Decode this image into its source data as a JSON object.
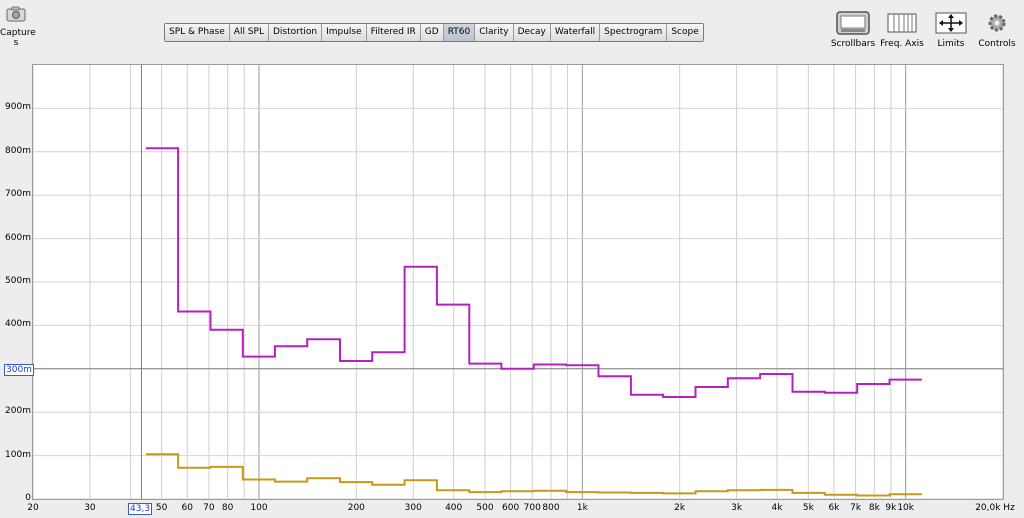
{
  "capture": {
    "label": "Capture",
    "label2": "s"
  },
  "tabs": [
    {
      "label": "SPL & Phase",
      "active": false
    },
    {
      "label": "All SPL",
      "active": false
    },
    {
      "label": "Distortion",
      "active": false
    },
    {
      "label": "Impulse",
      "active": false
    },
    {
      "label": "Filtered IR",
      "active": false
    },
    {
      "label": "GD",
      "active": false
    },
    {
      "label": "RT60",
      "active": true
    },
    {
      "label": "Clarity",
      "active": false
    },
    {
      "label": "Decay",
      "active": false
    },
    {
      "label": "Waterfall",
      "active": false
    },
    {
      "label": "Spectrogram",
      "active": false
    },
    {
      "label": "Scope",
      "active": false
    }
  ],
  "tools": {
    "scrollbars": "Scrollbars",
    "freq_axis": "Freq. Axis",
    "limits": "Limits",
    "controls": "Controls"
  },
  "markers": {
    "x_cursor": "43,3",
    "y_cursor": "300m"
  },
  "colors": {
    "series_1": "#b520c0",
    "series_2": "#c49a18",
    "cursor": "#808080"
  },
  "chart_data": {
    "type": "line",
    "x_scale": "log",
    "xlim": [
      20,
      20000
    ],
    "ylim": [
      0,
      1.0
    ],
    "x_tick_labels": [
      {
        "v": 20,
        "t": "20"
      },
      {
        "v": 30,
        "t": "30"
      },
      {
        "v": 40,
        "t": "4"
      },
      {
        "v": 50,
        "t": "50"
      },
      {
        "v": 60,
        "t": "60"
      },
      {
        "v": 70,
        "t": "70"
      },
      {
        "v": 80,
        "t": "80"
      },
      {
        "v": 100,
        "t": "100"
      },
      {
        "v": 200,
        "t": "200"
      },
      {
        "v": 300,
        "t": "300"
      },
      {
        "v": 400,
        "t": "400"
      },
      {
        "v": 500,
        "t": "500"
      },
      {
        "v": 600,
        "t": "600"
      },
      {
        "v": 700,
        "t": "700"
      },
      {
        "v": 800,
        "t": "800"
      },
      {
        "v": 1000,
        "t": "1k"
      },
      {
        "v": 2000,
        "t": "2k"
      },
      {
        "v": 3000,
        "t": "3k"
      },
      {
        "v": 4000,
        "t": "4k"
      },
      {
        "v": 5000,
        "t": "5k"
      },
      {
        "v": 6000,
        "t": "6k"
      },
      {
        "v": 7000,
        "t": "7k"
      },
      {
        "v": 8000,
        "t": "8k"
      },
      {
        "v": 9000,
        "t": "9k"
      },
      {
        "v": 10000,
        "t": "10k"
      },
      {
        "v": 20000,
        "t": "20,0k Hz"
      }
    ],
    "x_grid": [
      20,
      30,
      40,
      50,
      60,
      70,
      80,
      90,
      100,
      200,
      300,
      400,
      500,
      600,
      700,
      800,
      900,
      1000,
      2000,
      3000,
      4000,
      5000,
      6000,
      7000,
      8000,
      9000,
      10000,
      20000
    ],
    "x_grid_major": [
      100,
      1000,
      10000
    ],
    "y_tick_labels": [
      {
        "v": 0,
        "t": "0"
      },
      {
        "v": 0.1,
        "t": "100m"
      },
      {
        "v": 0.2,
        "t": "200m"
      },
      {
        "v": 0.3,
        "t": "300m"
      },
      {
        "v": 0.4,
        "t": "400m"
      },
      {
        "v": 0.5,
        "t": "500m"
      },
      {
        "v": 0.6,
        "t": "600m"
      },
      {
        "v": 0.7,
        "t": "700m"
      },
      {
        "v": 0.8,
        "t": "800m"
      },
      {
        "v": 0.9,
        "t": "900m"
      }
    ],
    "cursor": {
      "x": 43.3,
      "y": 0.3
    },
    "series": [
      {
        "color": "#b520c0",
        "bands": [
          {
            "lo": 44.7,
            "hi": 56.2,
            "v": 0.808
          },
          {
            "lo": 56.2,
            "hi": 70.8,
            "v": 0.432
          },
          {
            "lo": 70.8,
            "hi": 89.1,
            "v": 0.39
          },
          {
            "lo": 89.1,
            "hi": 112,
            "v": 0.328
          },
          {
            "lo": 112,
            "hi": 141,
            "v": 0.352
          },
          {
            "lo": 141,
            "hi": 178,
            "v": 0.368
          },
          {
            "lo": 178,
            "hi": 224,
            "v": 0.318
          },
          {
            "lo": 224,
            "hi": 282,
            "v": 0.338
          },
          {
            "lo": 282,
            "hi": 355,
            "v": 0.535
          },
          {
            "lo": 355,
            "hi": 447,
            "v": 0.448
          },
          {
            "lo": 447,
            "hi": 562,
            "v": 0.312
          },
          {
            "lo": 562,
            "hi": 708,
            "v": 0.3
          },
          {
            "lo": 708,
            "hi": 891,
            "v": 0.31
          },
          {
            "lo": 891,
            "hi": 1122,
            "v": 0.308
          },
          {
            "lo": 1122,
            "hi": 1413,
            "v": 0.283
          },
          {
            "lo": 1413,
            "hi": 1778,
            "v": 0.24
          },
          {
            "lo": 1778,
            "hi": 2239,
            "v": 0.235
          },
          {
            "lo": 2239,
            "hi": 2818,
            "v": 0.258
          },
          {
            "lo": 2818,
            "hi": 3548,
            "v": 0.278
          },
          {
            "lo": 3548,
            "hi": 4467,
            "v": 0.288
          },
          {
            "lo": 4467,
            "hi": 5623,
            "v": 0.247
          },
          {
            "lo": 5623,
            "hi": 7079,
            "v": 0.245
          },
          {
            "lo": 7079,
            "hi": 8913,
            "v": 0.265
          },
          {
            "lo": 8913,
            "hi": 11220,
            "v": 0.275
          }
        ]
      },
      {
        "color": "#c49a18",
        "bands": [
          {
            "lo": 44.7,
            "hi": 56.2,
            "v": 0.103
          },
          {
            "lo": 56.2,
            "hi": 70.8,
            "v": 0.072
          },
          {
            "lo": 70.8,
            "hi": 89.1,
            "v": 0.074
          },
          {
            "lo": 89.1,
            "hi": 112,
            "v": 0.045
          },
          {
            "lo": 112,
            "hi": 141,
            "v": 0.04
          },
          {
            "lo": 141,
            "hi": 178,
            "v": 0.048
          },
          {
            "lo": 178,
            "hi": 224,
            "v": 0.039
          },
          {
            "lo": 224,
            "hi": 282,
            "v": 0.033
          },
          {
            "lo": 282,
            "hi": 355,
            "v": 0.043
          },
          {
            "lo": 355,
            "hi": 447,
            "v": 0.02
          },
          {
            "lo": 447,
            "hi": 562,
            "v": 0.016
          },
          {
            "lo": 562,
            "hi": 708,
            "v": 0.018
          },
          {
            "lo": 708,
            "hi": 891,
            "v": 0.019
          },
          {
            "lo": 891,
            "hi": 1122,
            "v": 0.016
          },
          {
            "lo": 1122,
            "hi": 1413,
            "v": 0.015
          },
          {
            "lo": 1413,
            "hi": 1778,
            "v": 0.014
          },
          {
            "lo": 1778,
            "hi": 2239,
            "v": 0.013
          },
          {
            "lo": 2239,
            "hi": 2818,
            "v": 0.018
          },
          {
            "lo": 2818,
            "hi": 3548,
            "v": 0.02
          },
          {
            "lo": 3548,
            "hi": 4467,
            "v": 0.021
          },
          {
            "lo": 4467,
            "hi": 5623,
            "v": 0.014
          },
          {
            "lo": 5623,
            "hi": 7079,
            "v": 0.01
          },
          {
            "lo": 7079,
            "hi": 8913,
            "v": 0.008
          },
          {
            "lo": 8913,
            "hi": 11220,
            "v": 0.011
          }
        ]
      }
    ]
  }
}
